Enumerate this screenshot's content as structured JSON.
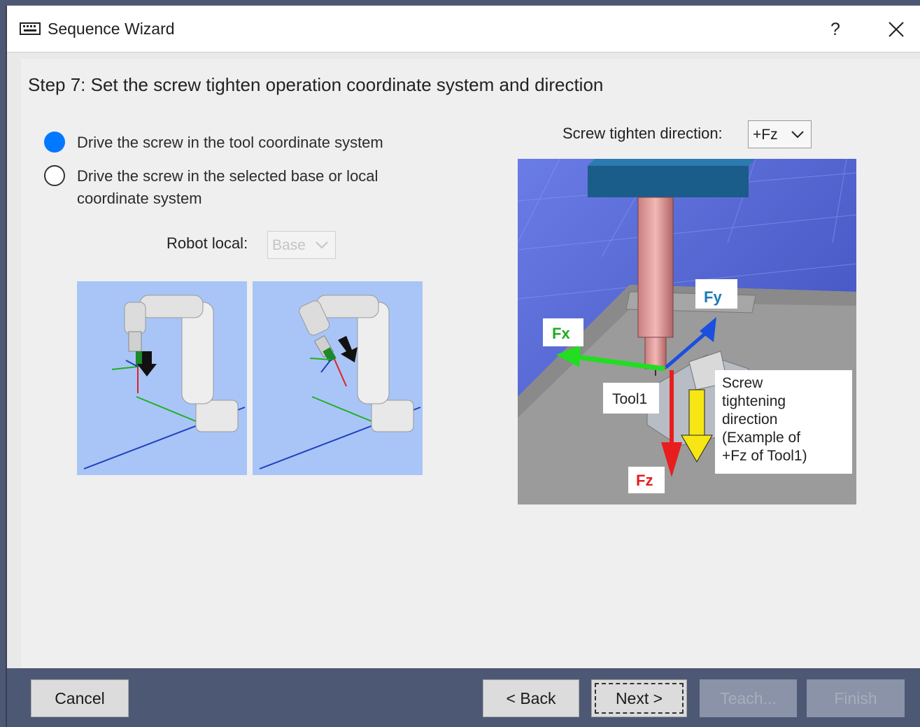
{
  "window": {
    "title": "Sequence Wizard",
    "help_label": "?",
    "close_icon": "close-icon",
    "app_icon": "keyboard-icon"
  },
  "step": {
    "title": "Step 7: Set the screw tighten operation coordinate system and direction"
  },
  "coordinate_options": [
    {
      "label": "Drive the screw in the tool coordinate system",
      "selected": true
    },
    {
      "label_line1": "Drive the screw in the selected base or local",
      "label_line2": "coordinate system",
      "selected": false
    }
  ],
  "robot_local": {
    "label": "Robot local:",
    "value": "Base",
    "enabled": false
  },
  "tighten_direction": {
    "label": "Screw tighten direction:",
    "value": "+Fz"
  },
  "illustration": {
    "fx_label": "Fx",
    "fy_label": "Fy",
    "fz_label": "Fz",
    "tool_label": "Tool1",
    "callout_lines": [
      "Screw",
      "tightening",
      "direction",
      "(Example of",
      "+Fz of Tool1)"
    ]
  },
  "buttons": {
    "cancel": "Cancel",
    "back": "< Back",
    "next": "Next >",
    "teach": "Teach...",
    "finish": "Finish"
  },
  "colors": {
    "selected_radio": "#0078ff",
    "footer_bg": "#4d5874",
    "fx_green": "#22dd22",
    "fy_blue": "#1a4fe0",
    "fz_red": "#e81e1e",
    "direction_yellow": "#f5e614"
  }
}
